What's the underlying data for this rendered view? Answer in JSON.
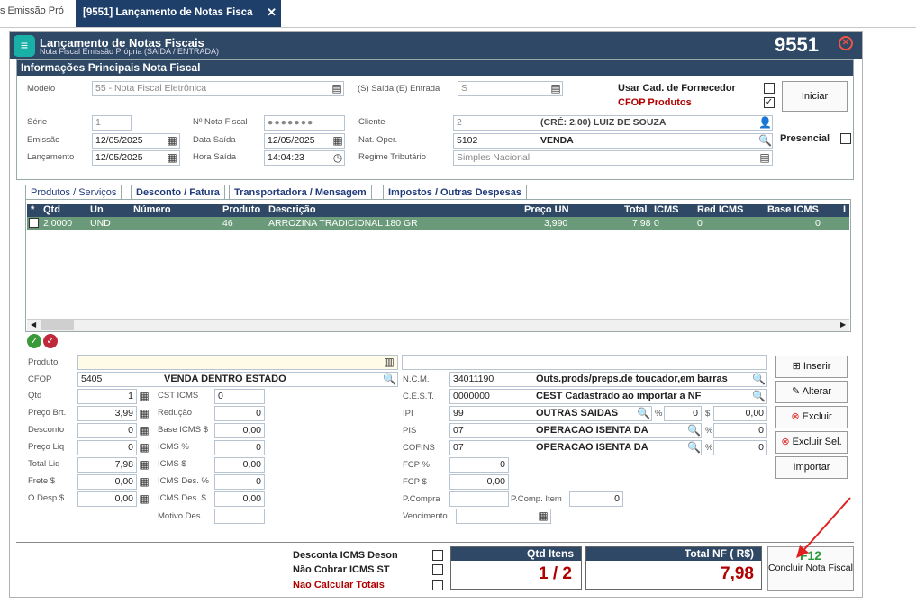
{
  "tabs": {
    "t1": "s Emissão Pró",
    "t2": "[9551] Lançamento de Notas Fisca",
    "close": "✕"
  },
  "window": {
    "title": "Lançamento de Notas Fiscais",
    "subtitle": "Nota Fiscal Emissão Própria  (SAÍDA / ENTRADA)",
    "number": "9551"
  },
  "header": {
    "title": "Informações Principais Nota Fiscal",
    "modelo_label": "Modelo",
    "modelo": "55 - Nota Fiscal Eletrônica",
    "se_label": "(S) Saída (E) Entrada",
    "se": "S",
    "usar_cad": "Usar Cad. de Fornecedor",
    "cfop_prod": "CFOP Produtos",
    "iniciar": "Iniciar",
    "serie_label": "Série",
    "serie": "1",
    "nnota_label": "Nº Nota Fiscal",
    "nnota": "●●●●●●●",
    "cliente_label": "Cliente",
    "cliente_code": "2",
    "cliente_name": "(CRÉ: 2,00) LUIZ DE SOUZA",
    "presencial": "Presencial",
    "emissao_label": "Emissão",
    "emissao": "12/05/2025",
    "datasaida_label": "Data Saída",
    "datasaida": "12/05/2025",
    "natoper_label": "Nat. Oper.",
    "natoper_code": "5102",
    "natoper": "VENDA",
    "lanc_label": "Lançamento",
    "lanc": "12/05/2025",
    "hora_label": "Hora Saída",
    "hora": "14:04:23",
    "regime_label": "Regime Tributário",
    "regime": "Simples Nacional"
  },
  "sectabs": [
    "Produtos / Serviços",
    "Desconto / Fatura",
    "Transportadora / Mensagem",
    "Impostos / Outras Despesas"
  ],
  "grid": {
    "cols": [
      "*",
      "Qtd",
      "Un",
      "Número",
      "Produto",
      "Descrição",
      "Preço UN",
      "Total",
      "ICMS",
      "Red ICMS",
      "Base ICMS",
      "I"
    ],
    "row": [
      "",
      "2,0000",
      "UND",
      "",
      "46",
      "ARROZINA TRADICIONAL 180 GR",
      "3,990",
      "7,98",
      "0",
      "0",
      "0"
    ]
  },
  "item": {
    "produto_label": "Produto",
    "cfop_label": "CFOP",
    "cfop": "5405",
    "cfop_desc": "VENDA DENTRO ESTADO",
    "qtd_label": "Qtd",
    "qtd": "1",
    "precobrt_label": "Preço Brt.",
    "precobrt": "3,99",
    "desconto_label": "Desconto",
    "desconto": "0",
    "precoliq_label": "Preço Liq",
    "precoliq": "0",
    "totalliq_label": "Total Liq",
    "totalliq": "7,98",
    "frete_label": "Frete $",
    "frete": "0,00",
    "odesp_label": "O.Desp.$",
    "odesp": "0,00",
    "cst_label": "CST ICMS",
    "cst": "0",
    "reducao_label": "Redução",
    "reducao": "0",
    "baseicms_label": "Base ICMS $",
    "baseicms": "0,00",
    "icmsp_label": "ICMS %",
    "icmsp": "0",
    "icmsv_label": "ICMS $",
    "icmsv": "0,00",
    "icmsdesp_label": "ICMS Des. %",
    "icmsdesp": "0",
    "icmsdesv_label": "ICMS Des. $",
    "icmsdesv": "0,00",
    "motivo_label": "Motivo Des.",
    "ncm_label": "N.C.M.",
    "ncm": "34011190",
    "ncm_desc": "Outs.prods/preps.de toucador,em barras",
    "cest_label": "C.E.S.T.",
    "cest": "0000000",
    "cest_desc": "CEST Cadastrado ao importar a NF",
    "ipi_label": "IPI",
    "ipi": "99",
    "ipi_desc": "OUTRAS SAIDAS",
    "ipi_pct": "0",
    "ipi_val": "0,00",
    "pis_label": "PIS",
    "pis": "07",
    "pis_desc": "OPERACAO ISENTA DA",
    "pis_pct": "0",
    "cofins_label": "COFINS",
    "cofins": "07",
    "cofins_desc": "OPERACAO ISENTA DA",
    "cofins_pct": "0",
    "fcpp_label": "FCP %",
    "fcpp": "0",
    "fcpv_label": "FCP $",
    "fcpv": "0,00",
    "pcompra_label": "P.Compra",
    "pcompitem_label": "P.Comp. Item",
    "pcompitem": "0",
    "venc_label": "Vencimento",
    "pct": "%",
    "dollar": "$"
  },
  "actions": {
    "inserir": "Inserir",
    "alterar": "Alterar",
    "excluir": "Excluir",
    "excluirsel": "Excluir Sel.",
    "importar": "Importar"
  },
  "footer": {
    "deson": "Desconta ICMS Deson",
    "naost": "Não Cobrar ICMS ST",
    "naocalc": "Nao Calcular Totais",
    "qtd_label": "Qtd Itens",
    "qtd": "1 / 2",
    "total_label": "Total NF ( R$)",
    "total": "7,98",
    "f12": "F12",
    "concluir": "Concluir Nota Fiscal"
  }
}
